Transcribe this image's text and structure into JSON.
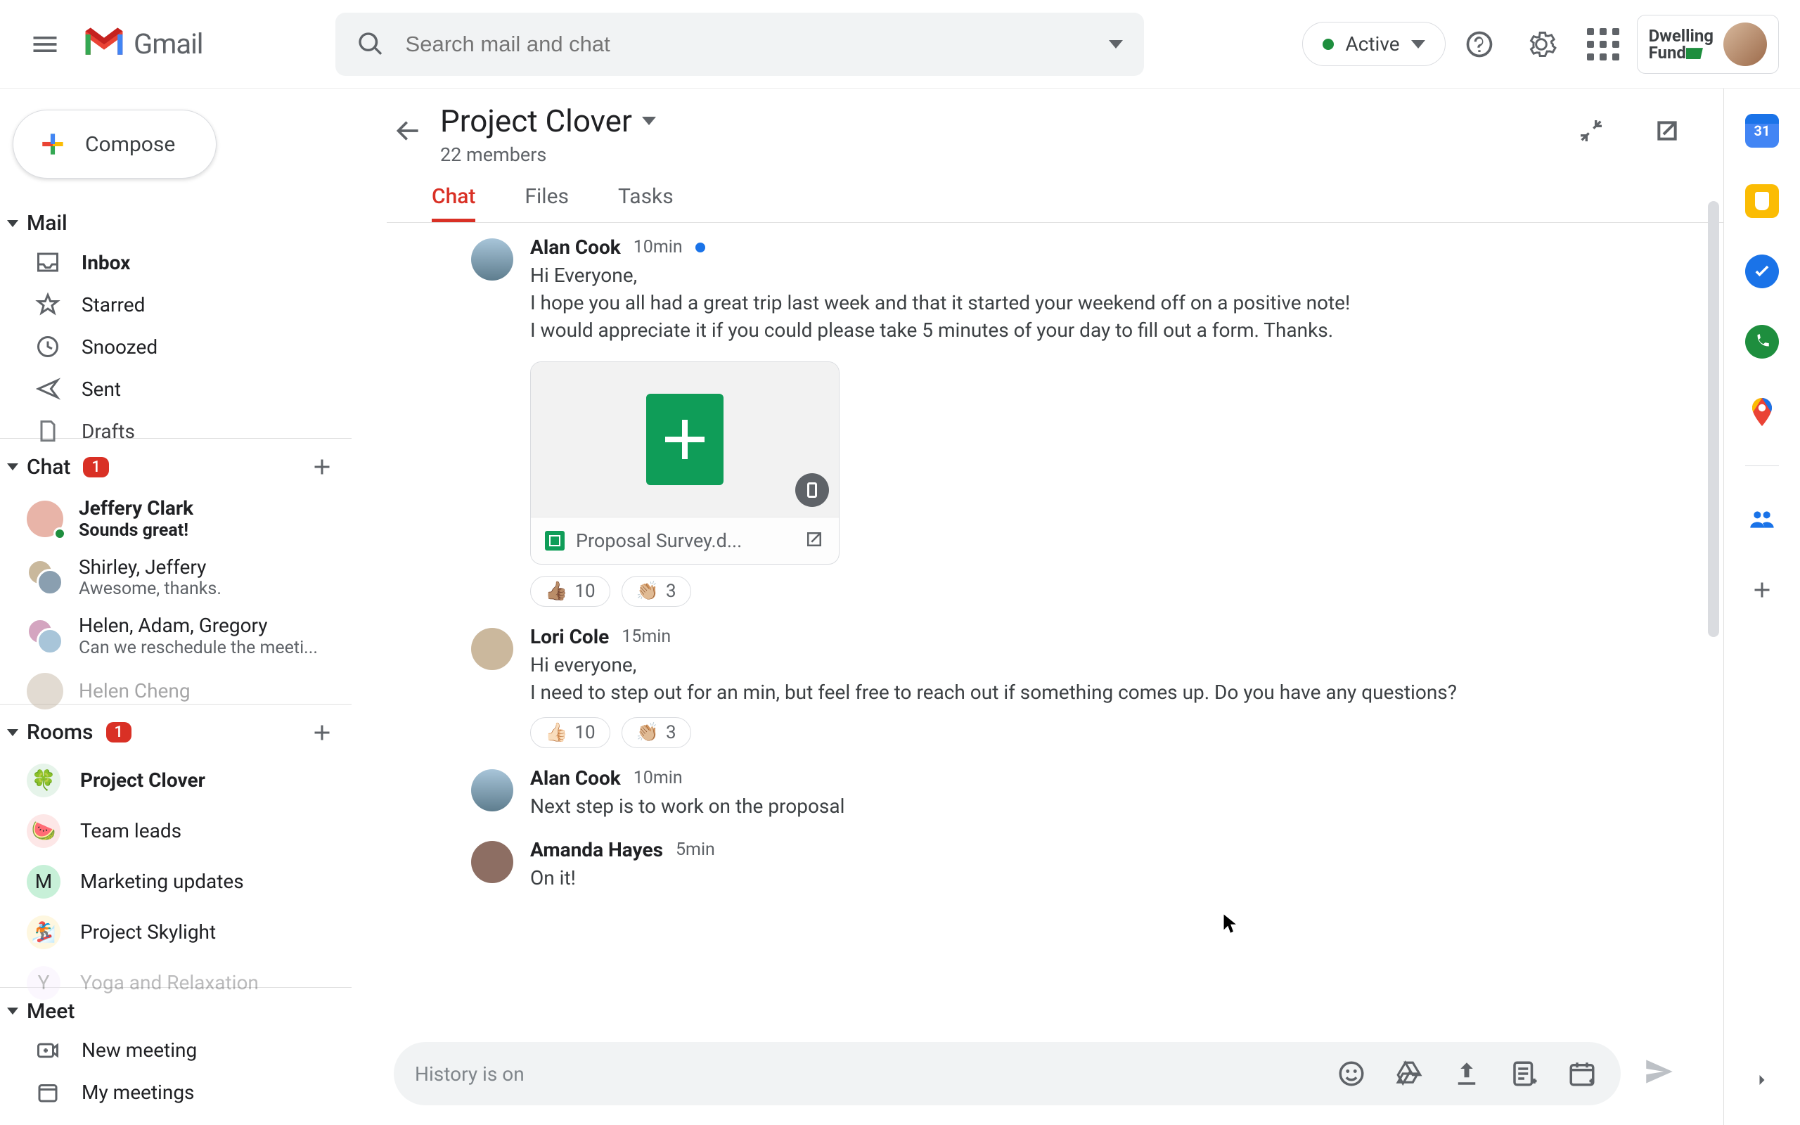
{
  "header": {
    "product_name": "Gmail",
    "search_placeholder": "Search mail and chat",
    "status_label": "Active",
    "brand_line1": "Dwelling",
    "brand_line2": "Fund"
  },
  "compose_label": "Compose",
  "mail": {
    "section": "Mail",
    "items": [
      "Inbox",
      "Starred",
      "Snoozed",
      "Sent",
      "Drafts"
    ]
  },
  "chat": {
    "section": "Chat",
    "badge": "1",
    "items": [
      {
        "name": "Jeffery Clark",
        "sub": "Sounds great!",
        "bold": true,
        "avatar": "#e8b4a8",
        "presence": true
      },
      {
        "name": "Shirley, Jeffery",
        "sub": "Awesome, thanks."
      },
      {
        "name": "Helen, Adam, Gregory",
        "sub": "Can we reschedule the meeti..."
      },
      {
        "name": "Helen Cheng",
        "sub": ""
      }
    ]
  },
  "rooms": {
    "section": "Rooms",
    "badge": "1",
    "items": [
      {
        "name": "Project Clover",
        "emoji": "🍀",
        "bg": "#e6f4ea",
        "bold": true
      },
      {
        "name": "Team leads",
        "emoji": "🍉",
        "bg": "#fde7e7"
      },
      {
        "name": "Marketing updates",
        "emoji": "M",
        "bg": "#c7f0d8"
      },
      {
        "name": "Project Skylight",
        "emoji": "🏂",
        "bg": "#fef7e0"
      },
      {
        "name": "Yoga and Relaxation",
        "emoji": "Y",
        "bg": "#f3e8fd"
      }
    ]
  },
  "meet": {
    "section": "Meet",
    "items": [
      "New meeting",
      "My meetings"
    ]
  },
  "pane": {
    "title": "Project Clover",
    "members": "22 members",
    "tabs": [
      "Chat",
      "Files",
      "Tasks"
    ],
    "active_tab": 0
  },
  "messages": [
    {
      "author": "Alan Cook",
      "time": "10min",
      "new": true,
      "avatar": "linear-gradient(180deg,#a8c5d9,#5e7d8e)",
      "lines": [
        "Hi Everyone,",
        "I hope you all had a great trip last week and that it started your weekend off on a positive note!",
        "I would appreciate it if you could please take 5 minutes of your day to fill out a form. Thanks."
      ],
      "attachment": {
        "name": "Proposal Survey.d..."
      },
      "reactions": [
        {
          "emoji": "👍🏽",
          "count": "10"
        },
        {
          "emoji": "👏🏼",
          "count": "3"
        }
      ]
    },
    {
      "author": "Lori Cole",
      "time": "15min",
      "avatar": "#cbb89d",
      "lines": [
        "Hi everyone,",
        "I need to step out for an min, but feel free to reach out if something comes up.  Do you have any questions?"
      ],
      "reactions": [
        {
          "emoji": "👍🏻",
          "count": "10"
        },
        {
          "emoji": "👏🏼",
          "count": "3"
        }
      ]
    },
    {
      "author": "Alan Cook",
      "time": "10min",
      "avatar": "linear-gradient(180deg,#a8c5d9,#5e7d8e)",
      "lines": [
        "Next step is to work on the proposal"
      ]
    },
    {
      "author": "Amanda Hayes",
      "time": "5min",
      "avatar": "#8d6e63",
      "lines": [
        "On it!"
      ]
    }
  ],
  "composer": {
    "placeholder": "History is on"
  },
  "sidepanel": {
    "calendar_day": "31"
  }
}
